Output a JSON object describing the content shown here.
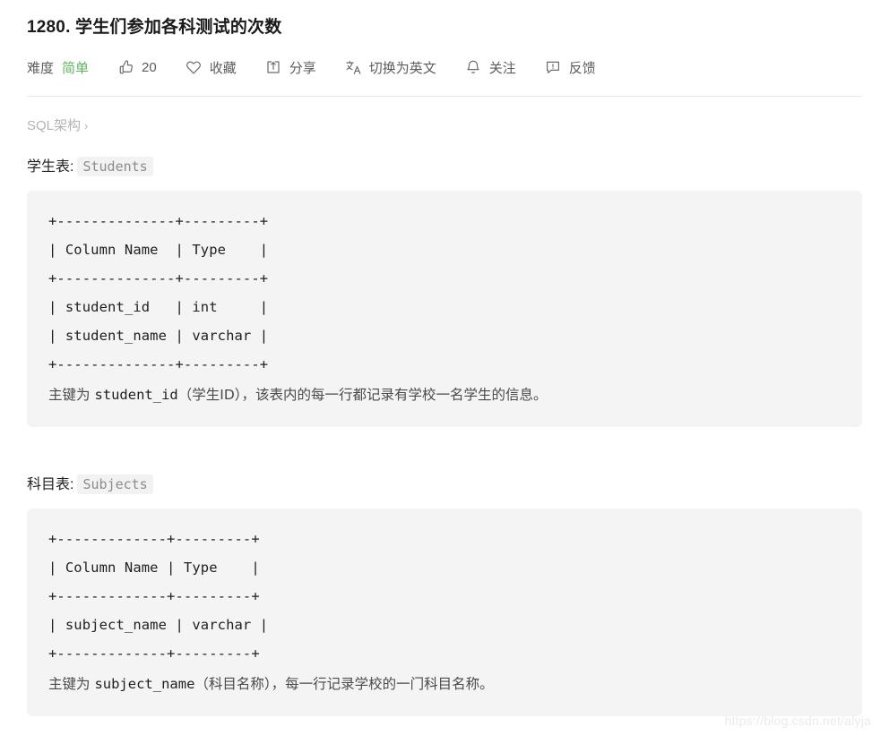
{
  "header": {
    "title": "1280. 学生们参加各科测试的次数"
  },
  "toolbar": {
    "difficulty_label": "难度",
    "difficulty_value": "简单",
    "difficulty_color": "#5cb85c",
    "like_icon": "thumbs-up-icon",
    "like_count": "20",
    "favorite_icon": "heart-icon",
    "favorite_label": "收藏",
    "share_icon": "share-icon",
    "share_label": "分享",
    "translate_icon": "translate-icon",
    "translate_label": "切换为英文",
    "subscribe_icon": "bell-icon",
    "subscribe_label": "关注",
    "feedback_icon": "feedback-icon",
    "feedback_label": "反馈"
  },
  "breadcrumb": {
    "label": "SQL架构",
    "chevron": "›"
  },
  "sections": [
    {
      "caption_label": "学生表:",
      "caption_code": "Students",
      "code": "+--------------+---------+\n| Column Name  | Type    |\n+--------------+---------+\n| student_id   | int     |\n| student_name | varchar |\n+--------------+---------+",
      "note_prefix": "主键为 ",
      "note_code": "student_id",
      "note_suffix": "（学生ID），该表内的每一行都记录有学校一名学生的信息。"
    },
    {
      "caption_label": "科目表:",
      "caption_code": "Subjects",
      "code": "+-------------+---------+\n| Column Name | Type    |\n+-------------+---------+\n| subject_name | varchar |\n+-------------+---------+",
      "note_prefix": "主键为 ",
      "note_code": "subject_name",
      "note_suffix": "（科目名称），每一行记录学校的一门科目名称。"
    }
  ],
  "watermark": {
    "text": "https://blog.csdn.net/alyja"
  }
}
